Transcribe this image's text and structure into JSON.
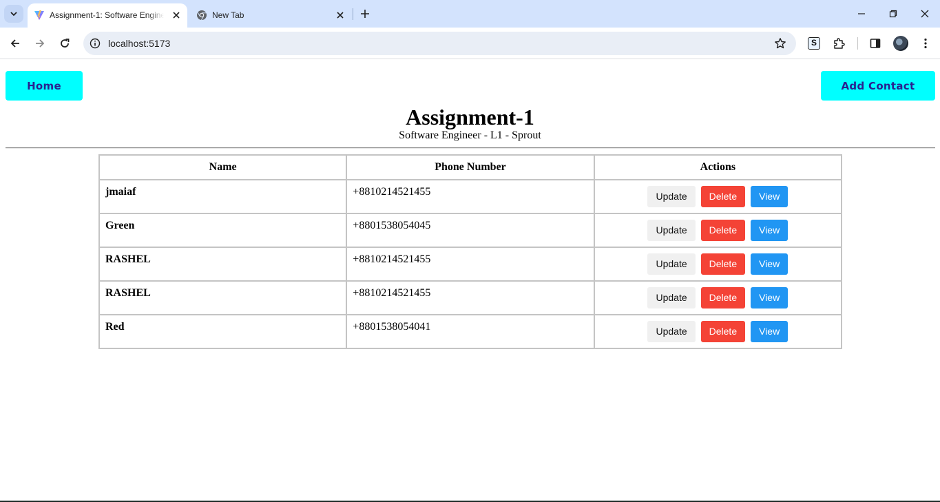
{
  "browser": {
    "tabs": [
      {
        "title": "Assignment-1: Software Engineer - L1 - Sprout",
        "favicon": "vite-icon",
        "active": true
      },
      {
        "title": "New Tab",
        "favicon": "chrome-icon",
        "active": false
      }
    ],
    "address": "localhost:5173",
    "colors": {
      "tabstrip": "#d3e3fd",
      "omnibox": "#e9eef6"
    }
  },
  "nav": {
    "home_label": "Home",
    "add_contact_label": "Add Contact",
    "button_color": "#00ffff",
    "button_text_color": "#2a1f8f"
  },
  "header": {
    "title": "Assignment-1",
    "subtitle": "Software Engineer - L1 - Sprout"
  },
  "table": {
    "columns": [
      "Name",
      "Phone Number",
      "Actions"
    ],
    "rows": [
      {
        "name": "jmaiaf",
        "phone": "+8810214521455"
      },
      {
        "name": "Green",
        "phone": "+8801538054045"
      },
      {
        "name": "RASHEL",
        "phone": "+8810214521455"
      },
      {
        "name": "RASHEL",
        "phone": "+8810214521455"
      },
      {
        "name": "Red",
        "phone": "+8801538054041"
      }
    ],
    "actions": {
      "update": "Update",
      "delete": "Delete",
      "view": "View"
    },
    "action_colors": {
      "update": "#f0f0f0",
      "delete": "#f44336",
      "view": "#2196f3"
    }
  }
}
